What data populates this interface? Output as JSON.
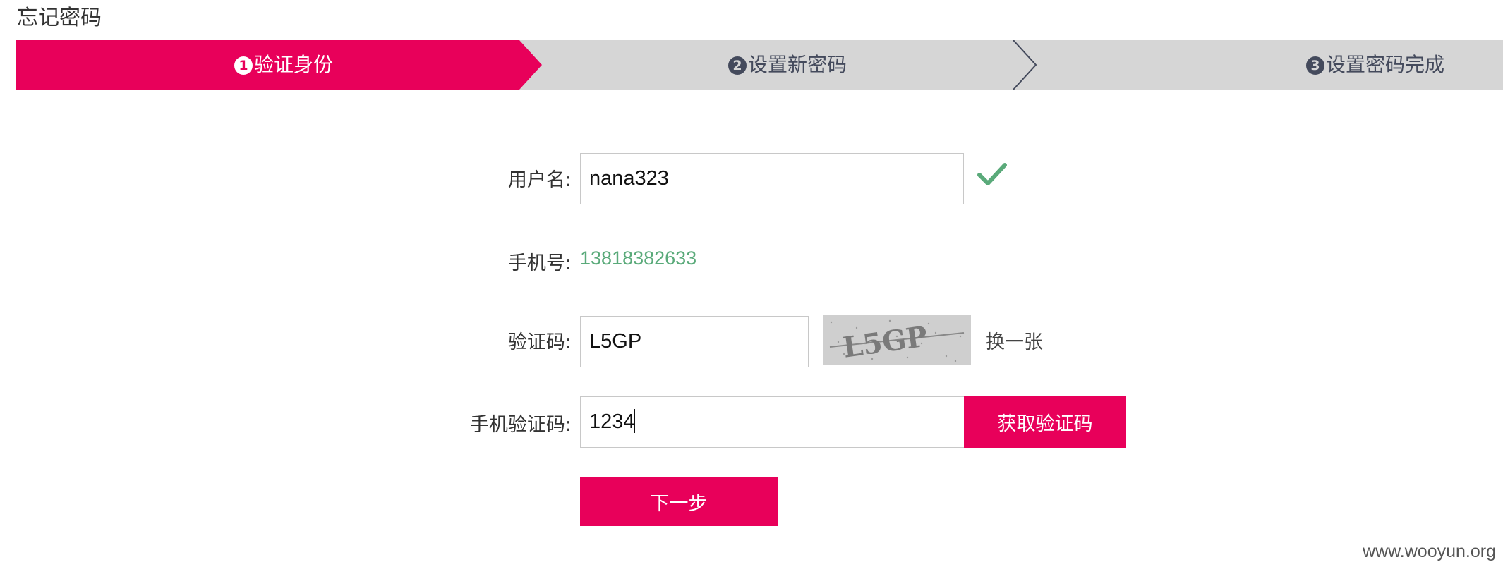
{
  "page": {
    "title": "忘记密码",
    "watermark": "www.wooyun.org"
  },
  "steps": [
    {
      "number": "1",
      "label": "验证身份",
      "active": true
    },
    {
      "number": "2",
      "label": "设置新密码",
      "active": false
    },
    {
      "number": "3",
      "label": "设置密码完成",
      "active": false
    }
  ],
  "colors": {
    "accent": "#e8005a",
    "step_inactive": "#d6d6d6",
    "step_text": "#444a5c",
    "success": "#5aaa7a"
  },
  "form": {
    "username": {
      "label": "用户名:",
      "value": "nana323",
      "status_icon": "check-icon"
    },
    "phone": {
      "label": "手机号:",
      "value": "13818382633"
    },
    "captcha": {
      "label": "验证码:",
      "value": "L5GP",
      "image_text": "L5GP",
      "refresh_label": "换一张"
    },
    "sms_code": {
      "label": "手机验证码:",
      "value": "1234",
      "button_label": "获取验证码"
    },
    "next_label": "下一步"
  }
}
